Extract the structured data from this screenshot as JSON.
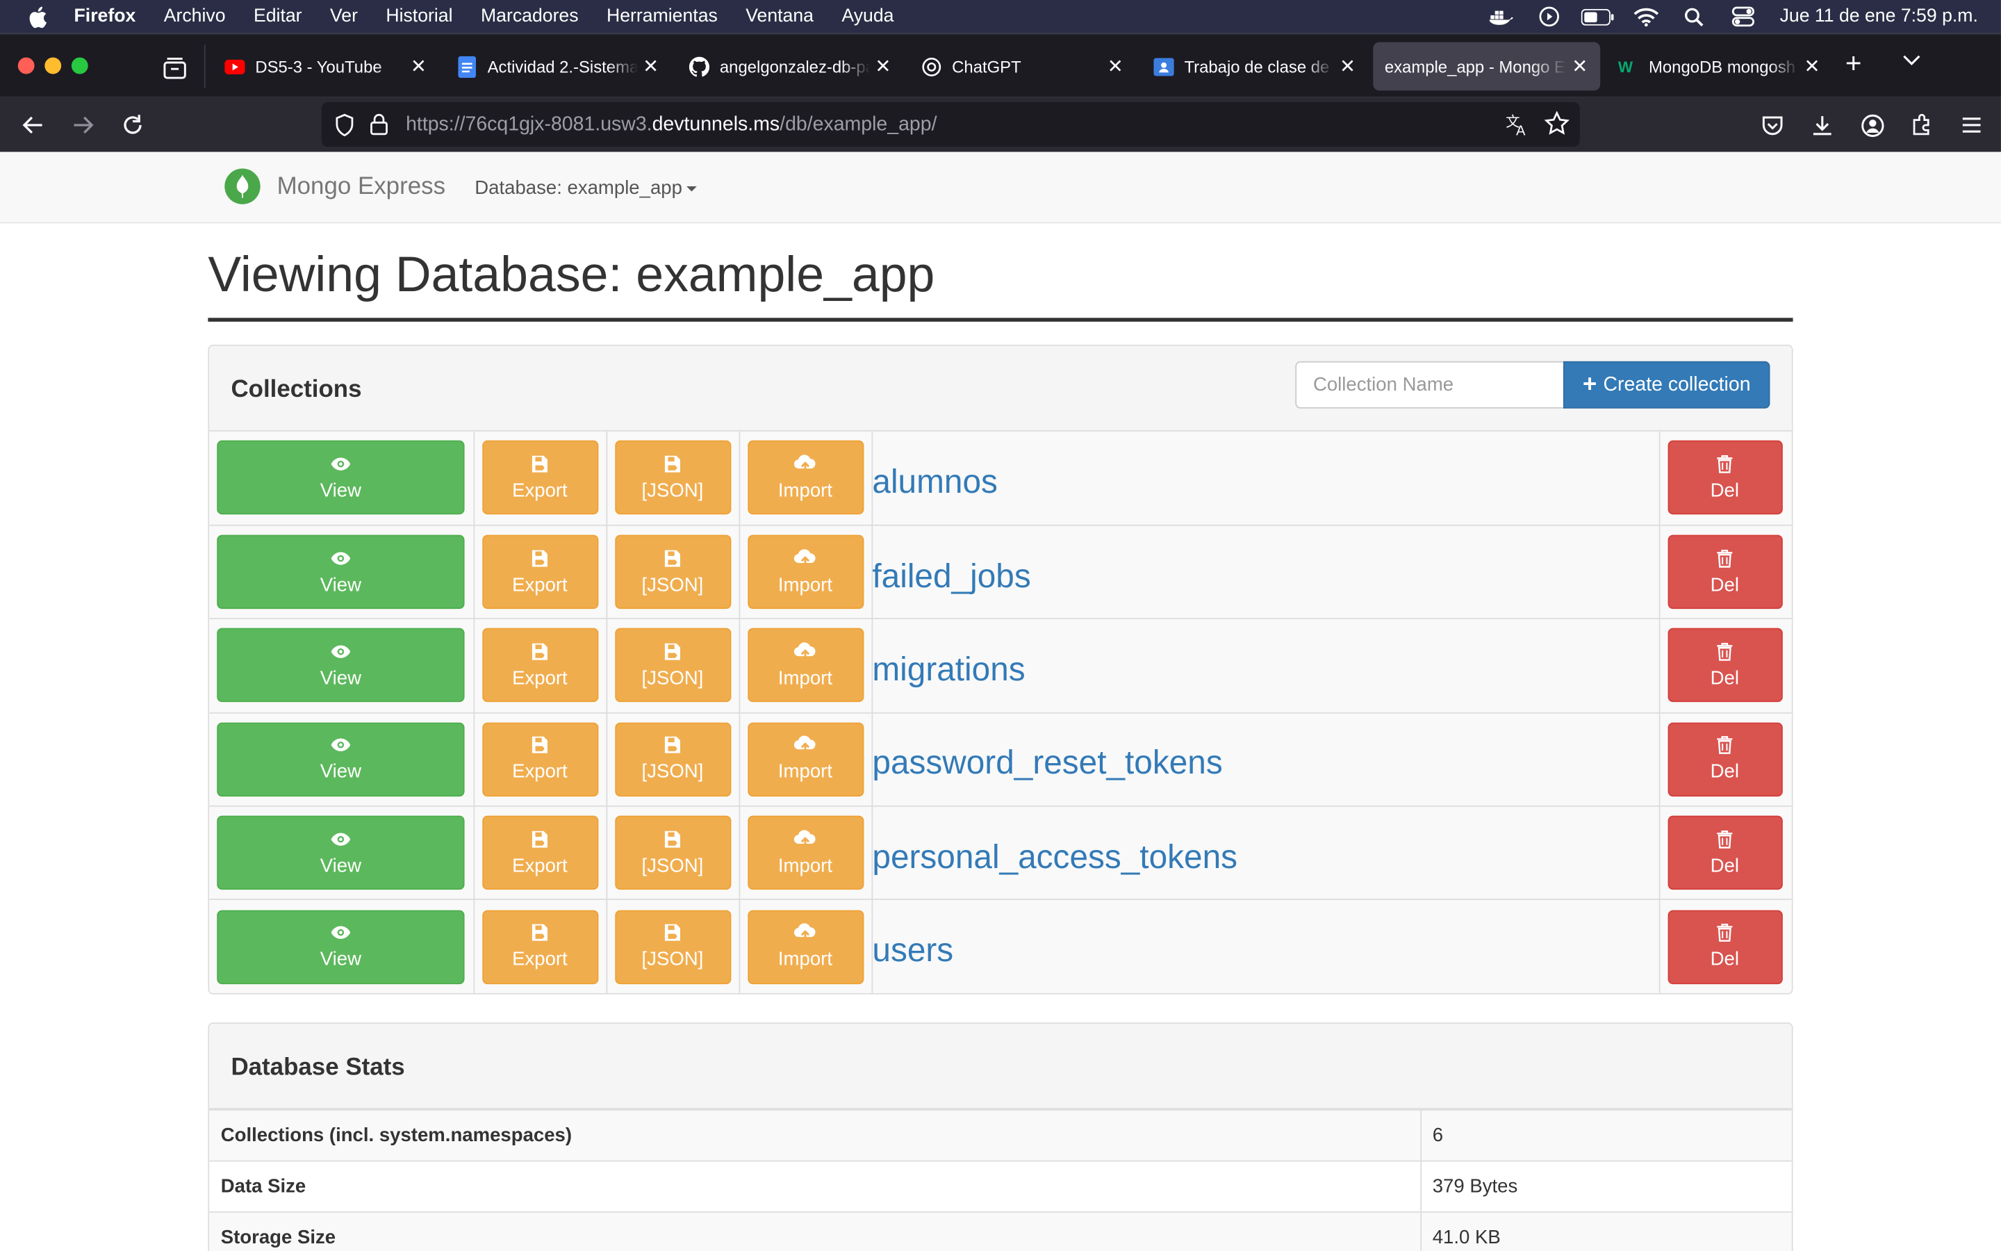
{
  "os_menubar": {
    "app_name": "Firefox",
    "menus": [
      "Archivo",
      "Editar",
      "Ver",
      "Historial",
      "Marcadores",
      "Herramientas",
      "Ventana",
      "Ayuda"
    ],
    "datetime": "Jue 11 de ene  7:59 p.m."
  },
  "tabs": [
    {
      "title": "DS5-3 - YouTube",
      "favicon": "youtube-icon",
      "active": false
    },
    {
      "title": "Actividad 2.-Sistema",
      "favicon": "docs-icon",
      "active": false
    },
    {
      "title": "angelgonzalez-db-pa",
      "favicon": "github-icon",
      "active": false
    },
    {
      "title": "ChatGPT",
      "favicon": "chatgpt-icon",
      "active": false
    },
    {
      "title": "Trabajo de clase de A",
      "favicon": "classroom-icon",
      "active": false
    },
    {
      "title": "example_app - Mongo Ex",
      "favicon": "none",
      "active": true
    },
    {
      "title": "MongoDB mongosh C",
      "favicon": "w3schools-icon",
      "active": false
    }
  ],
  "address_bar": {
    "url_prefix": "https://76cq1gjx-8081.usw3.",
    "url_domain": "devtunnels.ms",
    "url_path": "/db/example_app/"
  },
  "app_nav": {
    "brand": "Mongo Express",
    "db_dropdown": "Database: example_app"
  },
  "page": {
    "title": "Viewing Database: example_app"
  },
  "collections_panel": {
    "heading": "Collections",
    "input_placeholder": "Collection Name",
    "create_button": "Create collection",
    "button_labels": {
      "view": "View",
      "export": "Export",
      "json": "[JSON]",
      "import": "Import",
      "del": "Del"
    },
    "collections": [
      "alumnos",
      "failed_jobs",
      "migrations",
      "password_reset_tokens",
      "personal_access_tokens",
      "users"
    ]
  },
  "stats_panel": {
    "heading": "Database Stats",
    "rows": [
      {
        "label": "Collections (incl. system.namespaces)",
        "value": "6"
      },
      {
        "label": "Data Size",
        "value": "379 Bytes"
      },
      {
        "label": "Storage Size",
        "value": "41.0 KB"
      }
    ]
  },
  "colors": {
    "view_green": "#5cb85c",
    "export_orange": "#f0ad4e",
    "del_red": "#d9534f",
    "primary_blue": "#337ab7",
    "menubar_bg": "#2a2d45",
    "tabstrip_bg": "#1c1b22"
  }
}
